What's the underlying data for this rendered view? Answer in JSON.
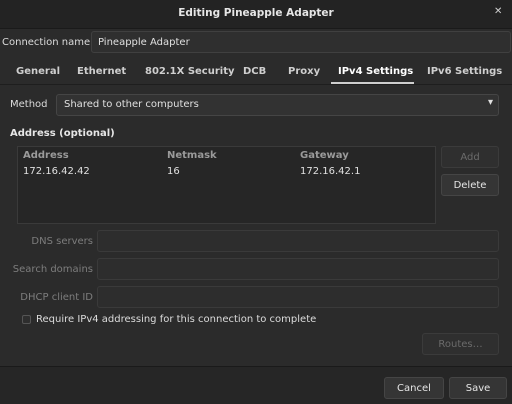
{
  "window": {
    "title": "Editing Pineapple Adapter",
    "close_icon": "close-icon"
  },
  "connection": {
    "label": "Connection name",
    "value": "Pineapple Adapter"
  },
  "tabs": [
    {
      "label": "General"
    },
    {
      "label": "Ethernet"
    },
    {
      "label": "802.1X Security"
    },
    {
      "label": "DCB"
    },
    {
      "label": "Proxy"
    },
    {
      "label": "IPv4 Settings",
      "active": true
    },
    {
      "label": "IPv6 Settings"
    }
  ],
  "method": {
    "label": "Method",
    "value": "Shared to other computers"
  },
  "address": {
    "section_label": "Address (optional)",
    "columns": [
      "Address",
      "Netmask",
      "Gateway"
    ],
    "rows": [
      [
        "172.16.42.42",
        "16",
        "172.16.42.1"
      ]
    ],
    "add_label": "Add",
    "delete_label": "Delete"
  },
  "fields": {
    "dns_label": "DNS servers",
    "search_label": "Search domains",
    "dhcp_label": "DHCP client ID"
  },
  "require_checkbox": {
    "label": "Require IPv4 addressing for this connection to complete",
    "checked": false
  },
  "routes_label": "Routes…",
  "footer": {
    "cancel_label": "Cancel",
    "save_label": "Save"
  }
}
